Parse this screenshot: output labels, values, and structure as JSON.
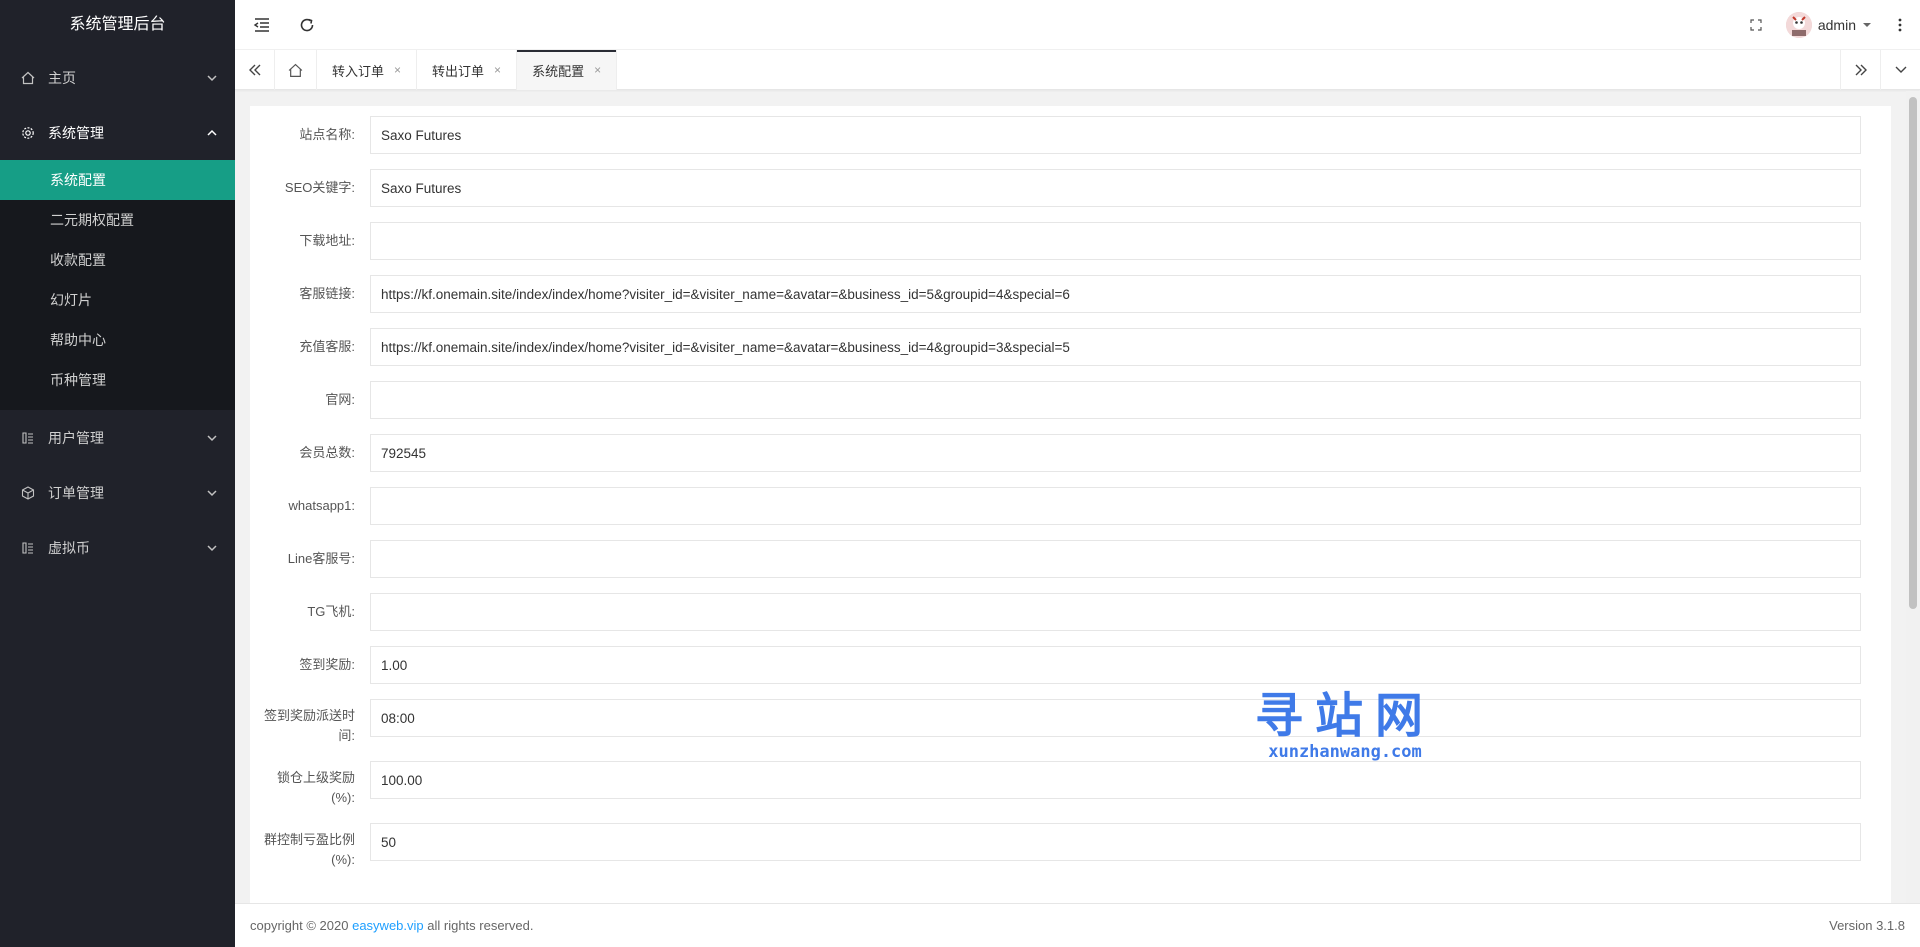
{
  "sidebar": {
    "logo": "系统管理后台",
    "home": "主页",
    "system": "系统管理",
    "sub_items": [
      "系统配置",
      "二元期权配置",
      "收款配置",
      "幻灯片",
      "帮助中心",
      "币种管理"
    ],
    "users": "用户管理",
    "orders": "订单管理",
    "crypto": "虚拟币"
  },
  "header": {
    "username": "admin"
  },
  "tabs": [
    {
      "label": "转入订单",
      "close": "×"
    },
    {
      "label": "转出订单",
      "close": "×"
    },
    {
      "label": "系统配置",
      "close": "×"
    }
  ],
  "form": {
    "fields": [
      {
        "label": "站点名称:",
        "value": "Saxo Futures"
      },
      {
        "label": "SEO关键字:",
        "value": "Saxo Futures"
      },
      {
        "label": "下载地址:",
        "value": ""
      },
      {
        "label": "客服链接:",
        "value": "https://kf.onemain.site/index/index/home?visiter_id=&visiter_name=&avatar=&business_id=5&groupid=4&special=6"
      },
      {
        "label": "充值客服:",
        "value": "https://kf.onemain.site/index/index/home?visiter_id=&visiter_name=&avatar=&business_id=4&groupid=3&special=5"
      },
      {
        "label": "官网:",
        "value": ""
      },
      {
        "label": "会员总数:",
        "value": "792545"
      },
      {
        "label": "whatsapp1:",
        "value": ""
      },
      {
        "label": "Line客服号:",
        "value": ""
      },
      {
        "label": "TG飞机:",
        "value": ""
      },
      {
        "label": "签到奖励:",
        "value": "1.00"
      },
      {
        "label": "签到奖励派送时间:",
        "value": "08:00"
      },
      {
        "label": "锁仓上级奖励(%):",
        "value": "100.00"
      },
      {
        "label": "群控制亏盈比例(%):",
        "value": "50"
      }
    ]
  },
  "footer": {
    "copyright_prefix": "copyright © 2020 ",
    "link": "easyweb.vip",
    "copyright_suffix": " all rights reserved.",
    "version": "Version 3.1.8"
  },
  "watermark": {
    "big": "寻站网",
    "small": "xunzhanwang.com"
  },
  "colors": {
    "sidebar_bg": "#20222a",
    "active_item": "#169e86",
    "link": "#1e9fff",
    "watermark": "#3f7ae8"
  }
}
